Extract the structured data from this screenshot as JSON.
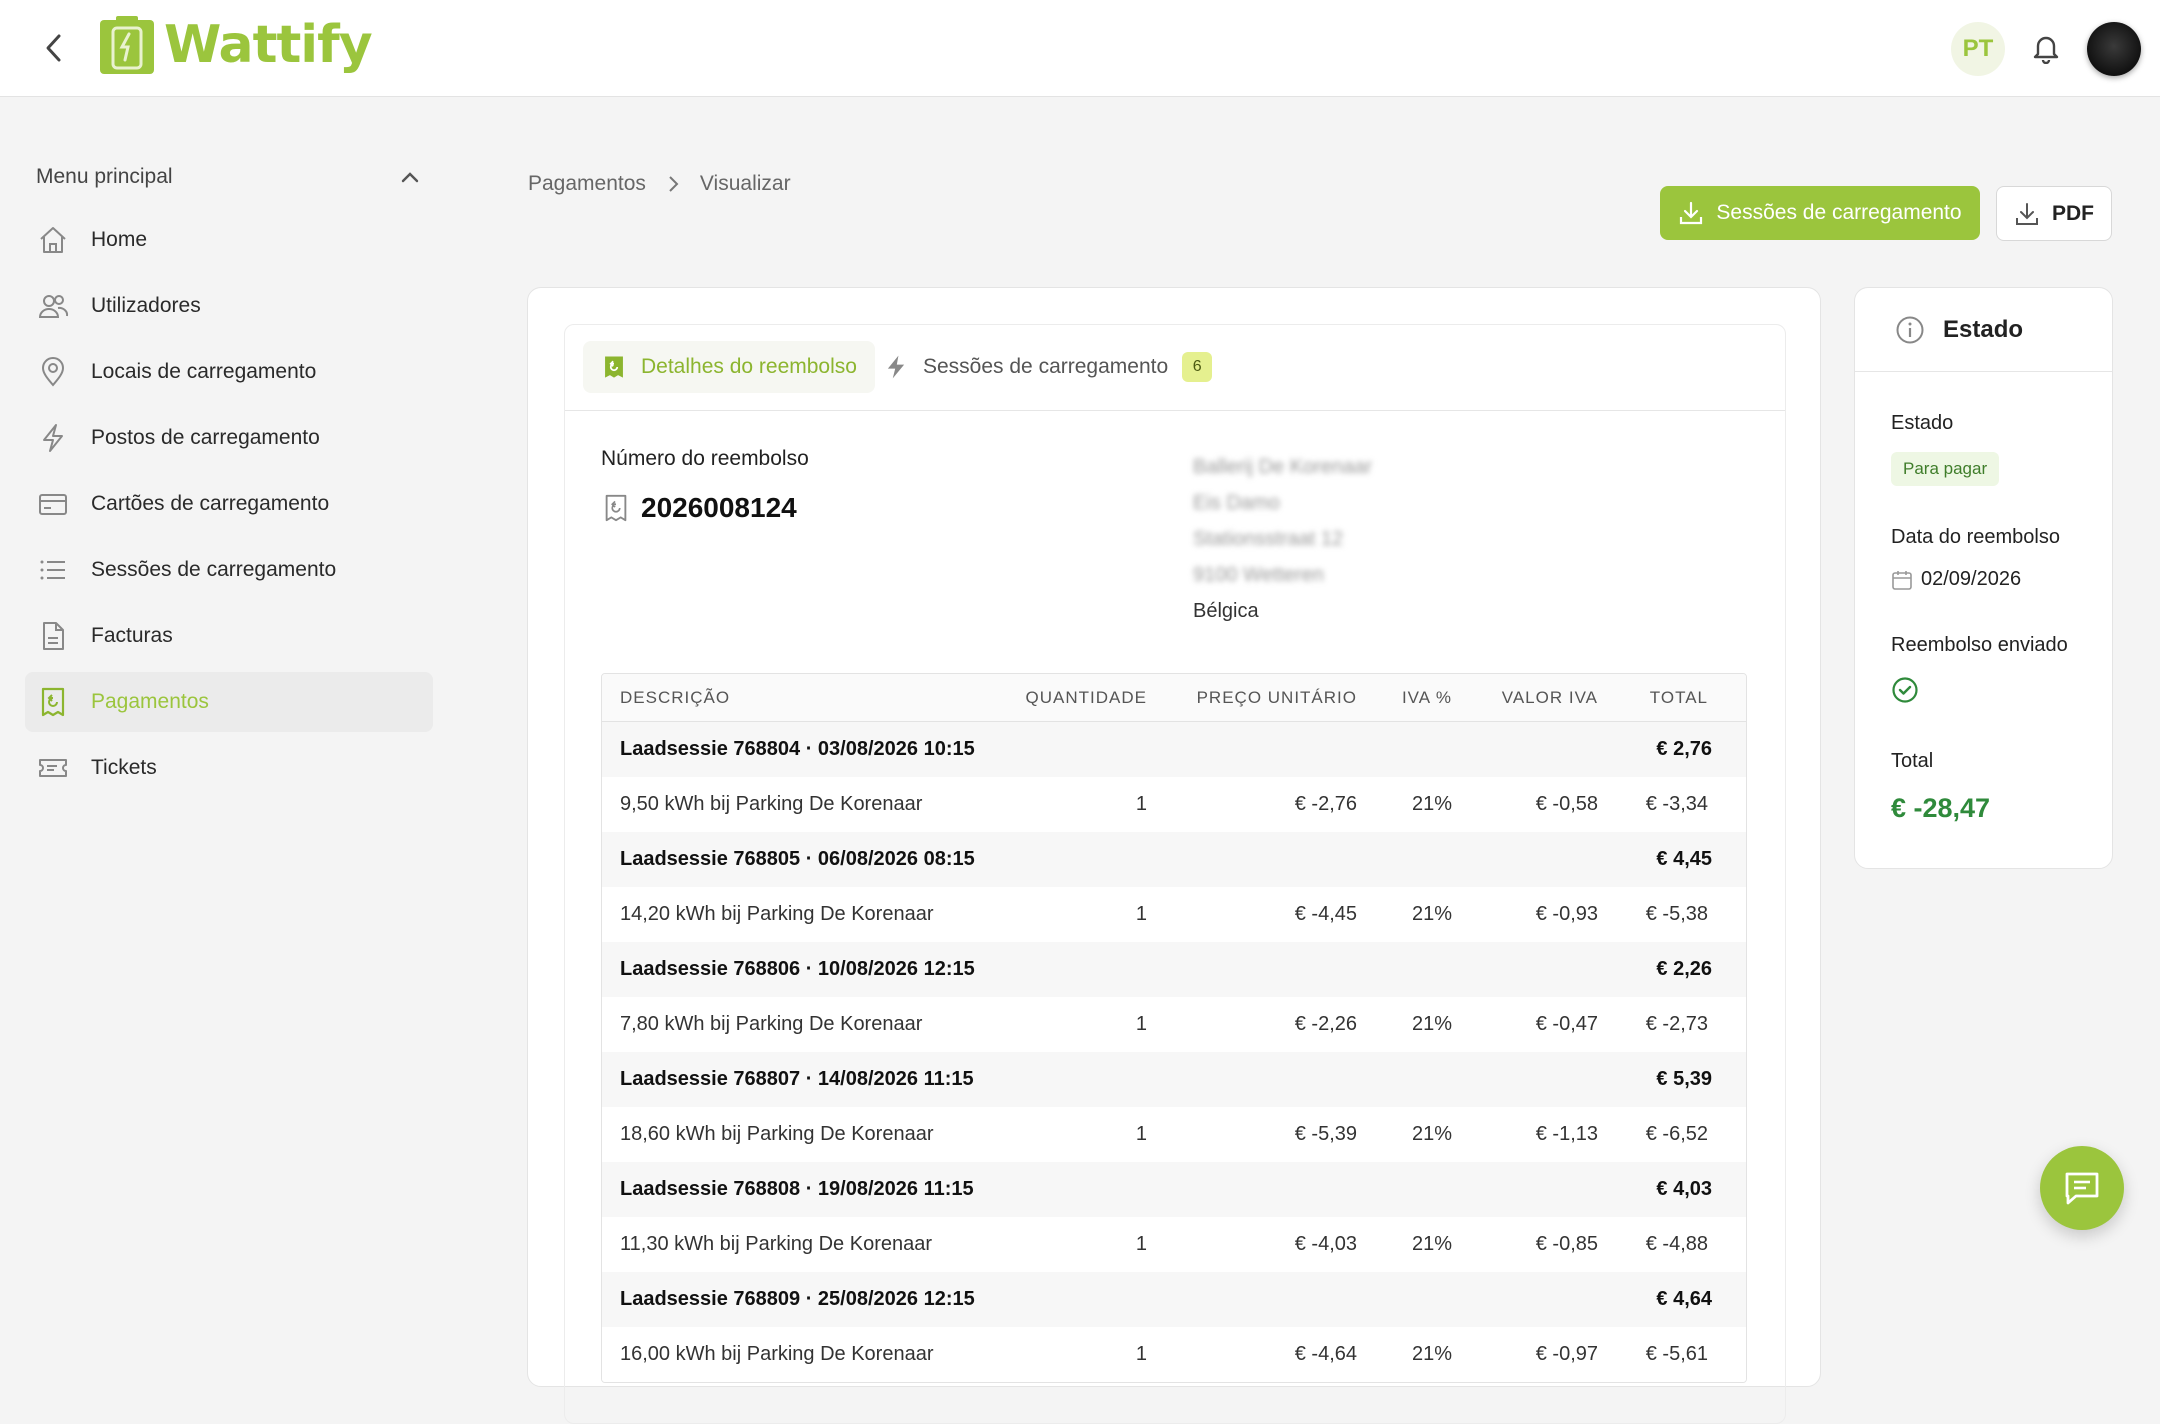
{
  "header": {
    "brand": "Wattify",
    "language": "PT"
  },
  "sidebar": {
    "title": "Menu principal",
    "items": [
      {
        "label": "Home",
        "icon": "home-icon"
      },
      {
        "label": "Utilizadores",
        "icon": "users-icon"
      },
      {
        "label": "Locais de carregamento",
        "icon": "location-pin-icon"
      },
      {
        "label": "Postos de carregamento",
        "icon": "lightning-icon"
      },
      {
        "label": "Cartões de carregamento",
        "icon": "card-icon"
      },
      {
        "label": "Sessões de carregamento",
        "icon": "list-icon"
      },
      {
        "label": "Facturas",
        "icon": "document-icon"
      },
      {
        "label": "Pagamentos",
        "icon": "refund-receipt-icon",
        "active": true
      },
      {
        "label": "Tickets",
        "icon": "ticket-icon"
      }
    ]
  },
  "breadcrumb": {
    "parent": "Pagamentos",
    "current": "Visualizar"
  },
  "actions": {
    "sessions_download": "Sessões de carregamento",
    "pdf": "PDF"
  },
  "tabs": {
    "details": "Detalhes do reembolso",
    "sessions": "Sessões de carregamento",
    "sessions_count": "6"
  },
  "refund": {
    "number_label": "Número do reembolso",
    "number": "2026008124",
    "address": {
      "line1": "Ballerij De Korenaar",
      "line2": "Eis Damo",
      "line3": "Stationsstraat 12",
      "line4": "9100 Wetteren",
      "country": "Bélgica"
    }
  },
  "table": {
    "headers": {
      "description": "DESCRIÇÃO",
      "quantity": "QUANTIDADE",
      "unit_price": "PREÇO UNITÁRIO",
      "vat_pct": "IVA %",
      "vat_value": "VALOR IVA",
      "total": "TOTAL"
    },
    "sessions": [
      {
        "title": "Laadsessie 768804 · 03/08/2026 10:15",
        "total": "€ 2,76",
        "line": {
          "description": "9,50 kWh bij Parking De Korenaar",
          "qty": "1",
          "unit": "€ -2,76",
          "vat": "21%",
          "vat_value": "€ -0,58",
          "total": "€ -3,34"
        }
      },
      {
        "title": "Laadsessie 768805 · 06/08/2026 08:15",
        "total": "€ 4,45",
        "line": {
          "description": "14,20 kWh bij Parking De Korenaar",
          "qty": "1",
          "unit": "€ -4,45",
          "vat": "21%",
          "vat_value": "€ -0,93",
          "total": "€ -5,38"
        }
      },
      {
        "title": "Laadsessie 768806 · 10/08/2026 12:15",
        "total": "€ 2,26",
        "line": {
          "description": "7,80 kWh bij Parking De Korenaar",
          "qty": "1",
          "unit": "€ -2,26",
          "vat": "21%",
          "vat_value": "€ -0,47",
          "total": "€ -2,73"
        }
      },
      {
        "title": "Laadsessie 768807 · 14/08/2026 11:15",
        "total": "€ 5,39",
        "line": {
          "description": "18,60 kWh bij Parking De Korenaar",
          "qty": "1",
          "unit": "€ -5,39",
          "vat": "21%",
          "vat_value": "€ -1,13",
          "total": "€ -6,52"
        }
      },
      {
        "title": "Laadsessie 768808 · 19/08/2026 11:15",
        "total": "€ 4,03",
        "line": {
          "description": "11,30 kWh bij Parking De Korenaar",
          "qty": "1",
          "unit": "€ -4,03",
          "vat": "21%",
          "vat_value": "€ -0,85",
          "total": "€ -4,88"
        }
      },
      {
        "title": "Laadsessie 768809 · 25/08/2026 12:15",
        "total": "€ 4,64",
        "line": {
          "description": "16,00 kWh bij Parking De Korenaar",
          "qty": "1",
          "unit": "€ -4,64",
          "vat": "21%",
          "vat_value": "€ -0,97",
          "total": "€ -5,61"
        }
      }
    ]
  },
  "status": {
    "title": "Estado",
    "state_label": "Estado",
    "state_value": "Para pagar",
    "date_label": "Data do reembolso",
    "date_value": "02/09/2026",
    "sent_label": "Reembolso enviado",
    "total_label": "Total",
    "total_value": "€ -28,47"
  },
  "colors": {
    "brand": "#9bc53d",
    "success": "#2f8a3b"
  }
}
